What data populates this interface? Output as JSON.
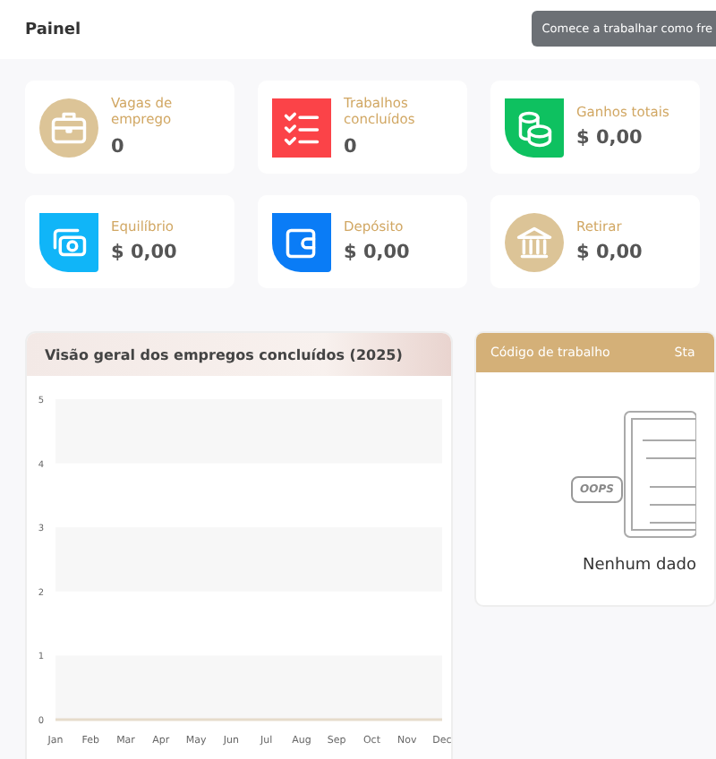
{
  "header": {
    "title": "Painel",
    "tooltip": "Comece a trabalhar como fre"
  },
  "cards": [
    {
      "label": "Vagas de emprego",
      "value": "0",
      "color": "#dcc497"
    },
    {
      "label": "Trabalhos concluídos",
      "value": "0",
      "color": "#fb4348"
    },
    {
      "label": "Ganhos totais",
      "value": "$ 0,00",
      "color": "#0ec160"
    },
    {
      "label": "Equilíbrio",
      "value": "$ 0,00",
      "color": "#10b5f8"
    },
    {
      "label": "Depósito",
      "value": "$ 0,00",
      "color": "#0a7cf6"
    },
    {
      "label": "Retirar",
      "value": "$ 0,00",
      "color": "#dcc497"
    }
  ],
  "chart_panel": {
    "title": "Visão geral dos empregos concluídos (2025)",
    "chart_data": {
      "type": "line",
      "categories": [
        "Jan",
        "Feb",
        "Mar",
        "Apr",
        "May",
        "Jun",
        "Jul",
        "Aug",
        "Sep",
        "Oct",
        "Nov",
        "Dec"
      ],
      "ylim": [
        0,
        5
      ],
      "yticks": [
        0,
        1,
        2,
        3,
        4,
        5
      ],
      "series": [
        {
          "color": "#e6dccb",
          "values": [
            0,
            0,
            0,
            0,
            0,
            0,
            0,
            0,
            0,
            0,
            0,
            0
          ]
        }
      ]
    }
  },
  "table": {
    "columns": [
      "Código de trabalho",
      "Sta"
    ],
    "empty_text": "Nenhum dado",
    "empty_badge": "OOPS"
  }
}
